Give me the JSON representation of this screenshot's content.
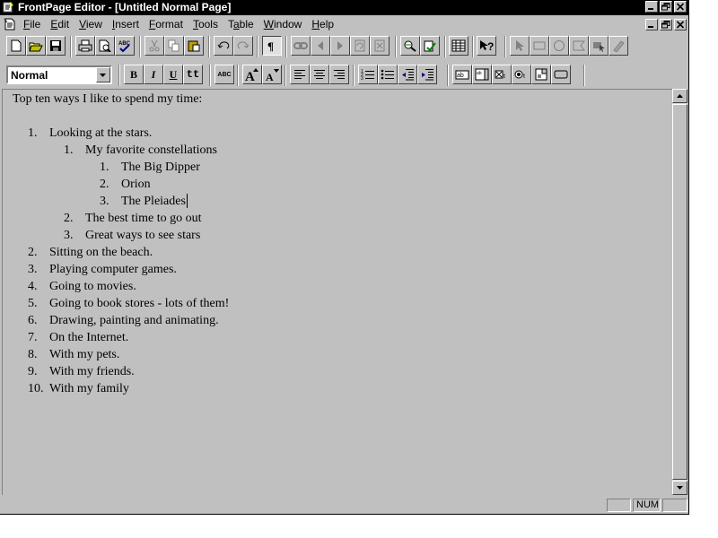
{
  "window": {
    "title": "FrontPage Editor - [Untitled Normal Page]"
  },
  "menubar": {
    "items": [
      {
        "label": "File",
        "hotkey": "F",
        "rest": "ile"
      },
      {
        "label": "Edit",
        "hotkey": "E",
        "rest": "dit"
      },
      {
        "label": "View",
        "hotkey": "V",
        "rest": "iew"
      },
      {
        "label": "Insert",
        "hotkey": "I",
        "rest": "nsert"
      },
      {
        "label": "Format",
        "hotkey": "F",
        "rest": "ormat"
      },
      {
        "label": "Tools",
        "hotkey": "T",
        "rest": "ools"
      },
      {
        "label": "Table",
        "hotkey": "a",
        "pre": "T",
        "rest": "ble"
      },
      {
        "label": "Window",
        "hotkey": "W",
        "rest": "indow"
      },
      {
        "label": "Help",
        "hotkey": "H",
        "rest": "elp"
      }
    ]
  },
  "format_toolbar": {
    "style_value": "Normal",
    "bold": "B",
    "italic": "I",
    "underline": "U",
    "typewriter": "tt",
    "abc": "ABC"
  },
  "document": {
    "heading": "Top ten ways I like to spend my time:",
    "list": [
      {
        "num": "1.",
        "text": "Looking at the stars.",
        "level": 1
      },
      {
        "num": "1.",
        "text": "My favorite constellations",
        "level": 2
      },
      {
        "num": "1.",
        "text": "The Big Dipper",
        "level": 3
      },
      {
        "num": "2.",
        "text": "Orion",
        "level": 3
      },
      {
        "num": "3.",
        "text": "The Pleiades",
        "level": 3
      },
      {
        "num": "2.",
        "text": "The best time to go out",
        "level": 2
      },
      {
        "num": "3.",
        "text": "Great ways to see stars",
        "level": 2
      },
      {
        "num": "2.",
        "text": "Sitting on the beach.",
        "level": 1
      },
      {
        "num": "3.",
        "text": "Playing computer games.",
        "level": 1
      },
      {
        "num": "4.",
        "text": "Going to movies.",
        "level": 1
      },
      {
        "num": "5.",
        "text": "Going to book stores - lots of them!",
        "level": 1
      },
      {
        "num": "6.",
        "text": "Drawing, painting and animating.",
        "level": 1
      },
      {
        "num": "7.",
        "text": "On the Internet.",
        "level": 1
      },
      {
        "num": "8.",
        "text": "With my pets.",
        "level": 1
      },
      {
        "num": "9.",
        "text": "With my friends.",
        "level": 1
      },
      {
        "num": "10.",
        "text": "With my family",
        "level": 1
      }
    ]
  },
  "statusbar": {
    "num_indicator": "NUM"
  },
  "colors": {
    "face": "#c0c0c0",
    "titlebar": "#000000",
    "editor_bg": "#c0c0c0"
  }
}
